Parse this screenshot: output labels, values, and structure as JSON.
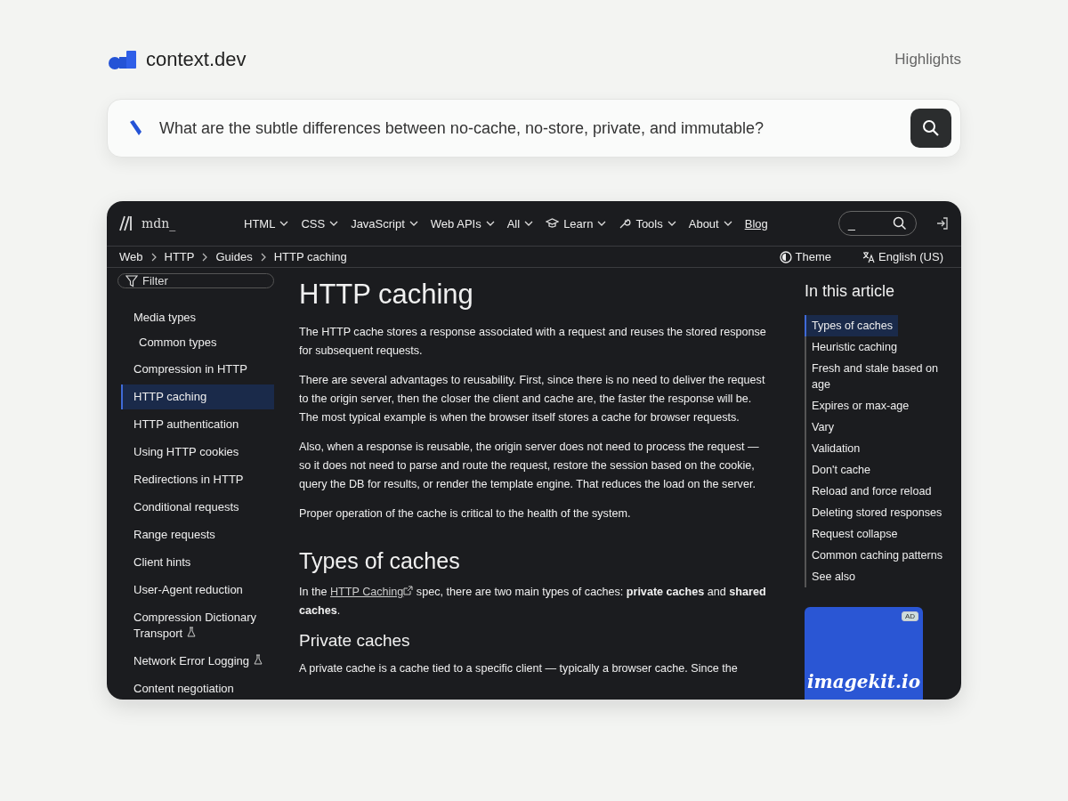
{
  "header": {
    "brand": "context.dev",
    "nav_link": "Highlights"
  },
  "search": {
    "value": "What are the subtle differences between no-cache, no-store, private, and immutable?"
  },
  "page": {
    "topbar": {
      "logo": "mdn_",
      "menus": [
        {
          "label": "HTML",
          "kind": "menu"
        },
        {
          "label": "CSS",
          "kind": "menu"
        },
        {
          "label": "JavaScript",
          "kind": "menu"
        },
        {
          "label": "Web APIs",
          "kind": "menu"
        },
        {
          "label": "All",
          "kind": "menu"
        },
        {
          "label": "Learn",
          "kind": "learn"
        },
        {
          "label": "Tools",
          "kind": "tools"
        },
        {
          "label": "About",
          "kind": "menu"
        },
        {
          "label": "Blog",
          "kind": "link"
        }
      ],
      "search_shortcut": "_"
    },
    "breadcrumbs": [
      "Web",
      "HTTP",
      "Guides",
      "HTTP caching"
    ],
    "theme_button": "Theme",
    "language_button": "English (US)",
    "sidebar": {
      "filter_placeholder": "Filter",
      "items": [
        {
          "label": "Media types",
          "selected": false,
          "experimental": false,
          "children": [
            {
              "label": "Common types",
              "selected": false
            }
          ]
        },
        {
          "label": "Compression in HTTP",
          "selected": false,
          "experimental": false
        },
        {
          "label": "HTTP caching",
          "selected": true,
          "experimental": false
        },
        {
          "label": "HTTP authentication",
          "selected": false,
          "experimental": false
        },
        {
          "label": "Using HTTP cookies",
          "selected": false,
          "experimental": false
        },
        {
          "label": "Redirections in HTTP",
          "selected": false,
          "experimental": false
        },
        {
          "label": "Conditional requests",
          "selected": false,
          "experimental": false
        },
        {
          "label": "Range requests",
          "selected": false,
          "experimental": false
        },
        {
          "label": "Client hints",
          "selected": false,
          "experimental": false
        },
        {
          "label": "User-Agent reduction",
          "selected": false,
          "experimental": false
        },
        {
          "label": "Compression Dictionary Transport",
          "selected": false,
          "experimental": true
        },
        {
          "label": "Network Error Logging",
          "selected": false,
          "experimental": true
        },
        {
          "label": "Content negotiation",
          "selected": false,
          "experimental": false
        }
      ]
    },
    "article": {
      "title": "HTTP caching",
      "blocks": [
        {
          "kind": "p",
          "text": "The HTTP cache stores a response associated with a request and reuses the stored response for subsequent requests."
        },
        {
          "kind": "p",
          "text": "There are several advantages to reusability. First, since there is no need to deliver the request to the origin server, then the closer the client and cache are, the faster the response will be. The most typical example is when the browser itself stores a cache for browser requests."
        },
        {
          "kind": "p",
          "text": "Also, when a response is reusable, the origin server does not need to process the request — so it does not need to parse and route the request, restore the session based on the cookie, query the DB for results, or render the template engine. That reduces the load on the server."
        },
        {
          "kind": "p",
          "text": "Proper operation of the cache is critical to the health of the system."
        },
        {
          "kind": "h2",
          "text": "Types of caches"
        },
        {
          "kind": "link_p",
          "before": "In the ",
          "link": "HTTP Caching",
          "after": " spec, there are two main types of caches: **private caches** and **shared caches**."
        },
        {
          "kind": "h3",
          "text": "Private caches"
        },
        {
          "kind": "p",
          "text": "A private cache is a cache tied to a specific client — typically a browser cache. Since the"
        }
      ]
    },
    "toc": {
      "title": "In this article",
      "items": [
        {
          "label": "Types of caches",
          "selected": true
        },
        {
          "label": "Heuristic caching",
          "selected": false
        },
        {
          "label": "Fresh and stale based on age",
          "selected": false
        },
        {
          "label": "Expires or max-age",
          "selected": false
        },
        {
          "label": "Vary",
          "selected": false
        },
        {
          "label": "Validation",
          "selected": false
        },
        {
          "label": "Don't cache",
          "selected": false
        },
        {
          "label": "Reload and force reload",
          "selected": false
        },
        {
          "label": "Deleting stored responses",
          "selected": false
        },
        {
          "label": "Request collapse",
          "selected": false
        },
        {
          "label": "Common caching patterns",
          "selected": false
        },
        {
          "label": "See also",
          "selected": false
        }
      ]
    },
    "ad": {
      "badge": "AD",
      "brand": "imagekit.io"
    }
  }
}
